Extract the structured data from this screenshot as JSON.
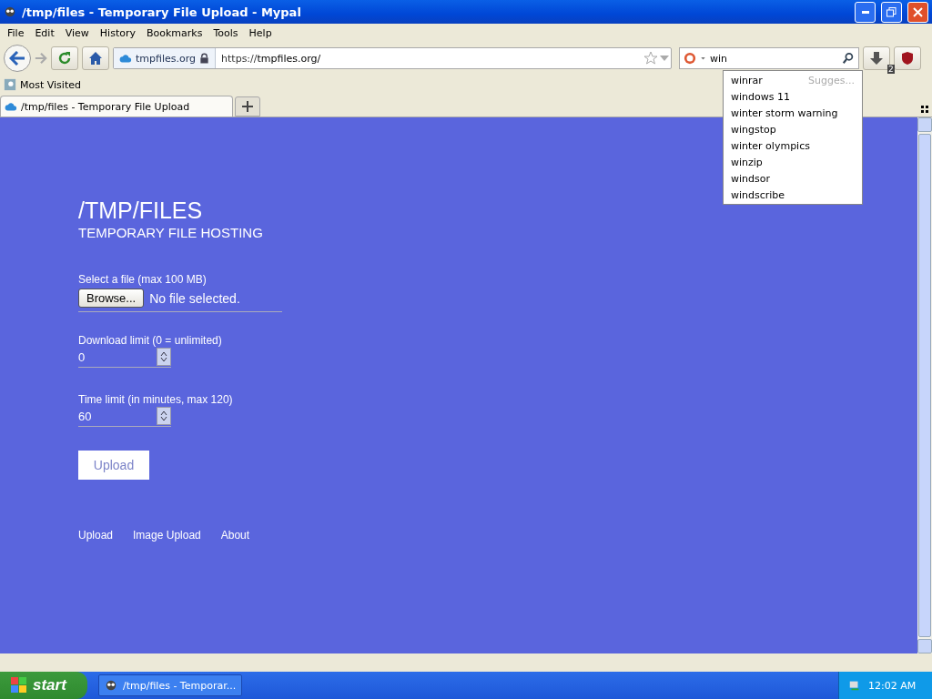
{
  "window": {
    "title": "/tmp/files - Temporary File Upload - Mypal"
  },
  "menu": [
    "File",
    "Edit",
    "View",
    "History",
    "Bookmarks",
    "Tools",
    "Help"
  ],
  "navbar": {
    "identity": "tmpfiles.org",
    "url_scheme": "https://",
    "url_host": "tmpfiles.org/",
    "search_value": "win",
    "addon_badge": "2"
  },
  "suggestions": {
    "header": "Sugges...",
    "items": [
      "winrar",
      "windows 11",
      "winter storm warning",
      "wingstop",
      "winter olympics",
      "winzip",
      "windsor",
      "windscribe"
    ]
  },
  "bookmarks": [
    "Most Visited"
  ],
  "tabs": [
    {
      "label": "/tmp/files - Temporary File Upload",
      "selected": true
    }
  ],
  "page": {
    "heading": "/TMP/FILES",
    "subheading": "TEMPORARY FILE HOSTING",
    "file_label": "Select a file (max 100 MB)",
    "browse": "Browse...",
    "file_status": "No file selected.",
    "download_label": "Download limit (0 = unlimited)",
    "download_value": "0",
    "time_label": "Time limit (in minutes, max 120)",
    "time_value": "60",
    "upload": "Upload",
    "footer_links": [
      "Upload",
      "Image Upload",
      "About"
    ]
  },
  "taskbar": {
    "start": "start",
    "task": "/tmp/files - Temporar...",
    "clock": "12:02 AM"
  }
}
